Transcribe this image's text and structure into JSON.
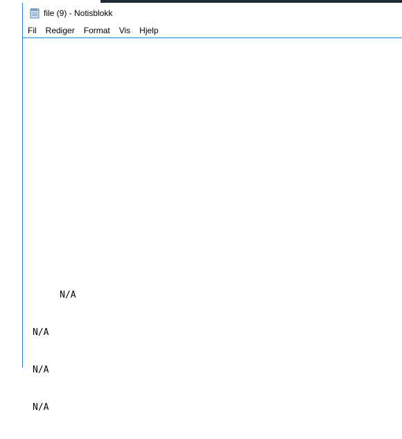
{
  "window": {
    "title": "file (9) - Notisblokk",
    "icon": "notepad-icon"
  },
  "menubar": {
    "items": [
      "Fil",
      "Rediger",
      "Format",
      "Vis",
      "Hjelp"
    ]
  },
  "editor": {
    "lines": [
      "     N/A",
      "N/A",
      "N/A",
      "N/A"
    ]
  }
}
